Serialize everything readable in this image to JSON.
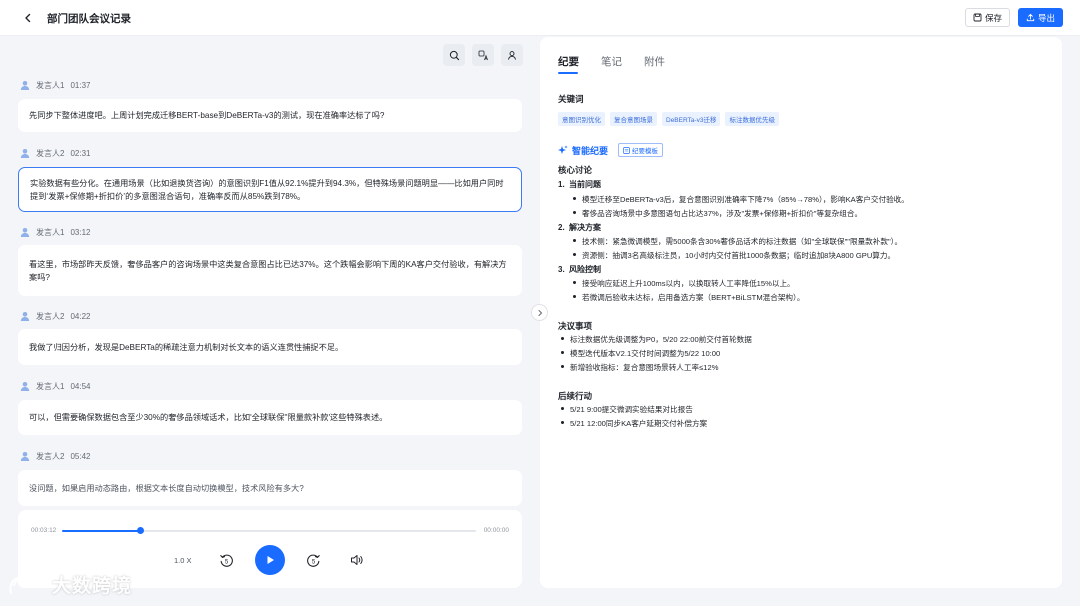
{
  "header": {
    "title": "部门团队会议记录",
    "save_label": "保存",
    "export_label": "导出"
  },
  "transcript": [
    {
      "speaker": "发言人1",
      "time": "01:37",
      "text": "先同步下整体进度吧。上周计划完成迁移BERT-base到DeBERTa-v3的测试，现在准确率达标了吗?"
    },
    {
      "speaker": "发言人2",
      "time": "02:31",
      "text": "实验数据有些分化。在通用场景（比如退换货咨询）的意图识别F1值从92.1%提升到94.3%，但特殊场景问题明显——比如用户同时提到‘发票+保修期+折扣价’的多意图混合语句，准确率反而从85%跌到78%。"
    },
    {
      "speaker": "发言人1",
      "time": "03:12",
      "text": "看这里，市场部昨天反馈，奢侈品客户的咨询场景中这类复合意图占比已达37%。这个跌幅会影响下周的KA客户交付验收，有解决方案吗?"
    },
    {
      "speaker": "发言人2",
      "time": "04:22",
      "text": "我做了归因分析，发现是DeBERTa的稀疏注意力机制对长文本的语义连贯性捕捉不足。"
    },
    {
      "speaker": "发言人1",
      "time": "04:54",
      "text": "可以，但需要确保数据包含至少30%的奢侈品领域话术，比如'全球联保''限量款补款'这些特殊表述。"
    },
    {
      "speaker": "发言人2",
      "time": "05:42",
      "text": "没问题，如果启用动态路由，根据文本长度自动切换模型，技术风险有多大?"
    }
  ],
  "player": {
    "current_time": "00:03:12",
    "total_time": "00:00:00",
    "progress": 0.19,
    "speed": "1.0 X",
    "skip_back": "5",
    "skip_forward": "5"
  },
  "tabs": [
    {
      "label": "纪要",
      "active": true
    },
    {
      "label": "笔记",
      "active": false
    },
    {
      "label": "附件",
      "active": false
    }
  ],
  "keywords": {
    "title": "关键词",
    "items": [
      "意图识别优化",
      "复合意图场景",
      "DeBERTa-v3迁移",
      "标注数据优先级"
    ]
  },
  "smart_summary": {
    "title": "智能纪要",
    "template_label": "纪要模板"
  },
  "core_discussion": {
    "title": "核心讨论",
    "sections": [
      {
        "num": "1.",
        "title": "当前问题",
        "bullets": [
          "模型迁移至DeBERTa-v3后，复合意图识别准确率下降7%（85%→78%），影响KA客户交付验收。",
          "奢侈品咨询场景中多意图语句占比达37%，涉及\"发票+保修期+折扣价\"等复杂组合。"
        ]
      },
      {
        "num": "2.",
        "title": "解决方案",
        "bullets": [
          "技术侧：紧急微调模型，需5000条含30%奢侈品话术的标注数据（如\"全球联保\"\"限量款补款\"）。",
          "资源侧：抽调3名高级标注员，10小时内交付首批1000条数据；临时追加8块A800 GPU算力。"
        ]
      },
      {
        "num": "3.",
        "title": "风险控制",
        "bullets": [
          "接受响应延迟上升100ms以内，以换取转人工率降低15%以上。",
          "若微调后验收未达标，启用备选方案（BERT+BiLSTM混合架构）。"
        ]
      }
    ]
  },
  "decisions": {
    "title": "决议事项",
    "items": [
      "标注数据优先级调整为P0，5/20 22:00前交付首轮数据",
      "模型迭代版本V2.1交付时间调整为5/22 10:00",
      "新增验收指标：复合意图场景转人工率≤12%"
    ]
  },
  "follow_up": {
    "title": "后续行动",
    "items": [
      "5/21 9:00提交微调实验结果对比报告",
      "5/21 12:00同步KA客户延期交付补偿方案"
    ]
  },
  "watermark": {
    "text": "大数跨境"
  },
  "colors": {
    "accent": "#1a6bff",
    "page_bg": "#f3f5f9",
    "keyword_bg": "#eaf1ff"
  }
}
